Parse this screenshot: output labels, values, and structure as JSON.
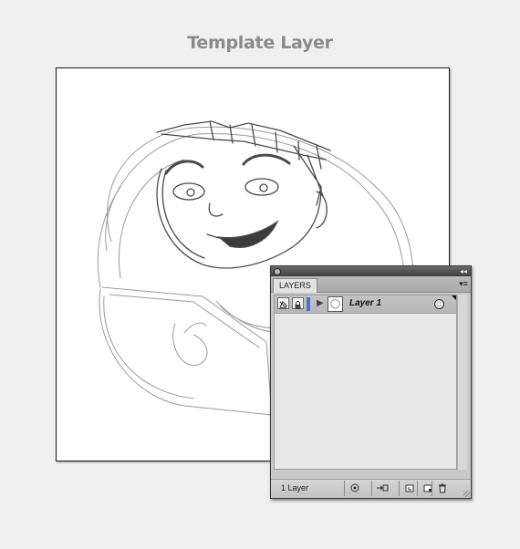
{
  "page": {
    "title": "Template Layer"
  },
  "layers_panel": {
    "tab_label": "LAYERS",
    "layers": [
      {
        "name": "Layer 1",
        "color": "#4f6fd6"
      }
    ],
    "footer": {
      "count_text": "1 Layer",
      "buttons": [
        "locate-object",
        "make-clipping-mask",
        "create-new-sublayer",
        "create-new-layer",
        "delete-selection"
      ]
    }
  }
}
